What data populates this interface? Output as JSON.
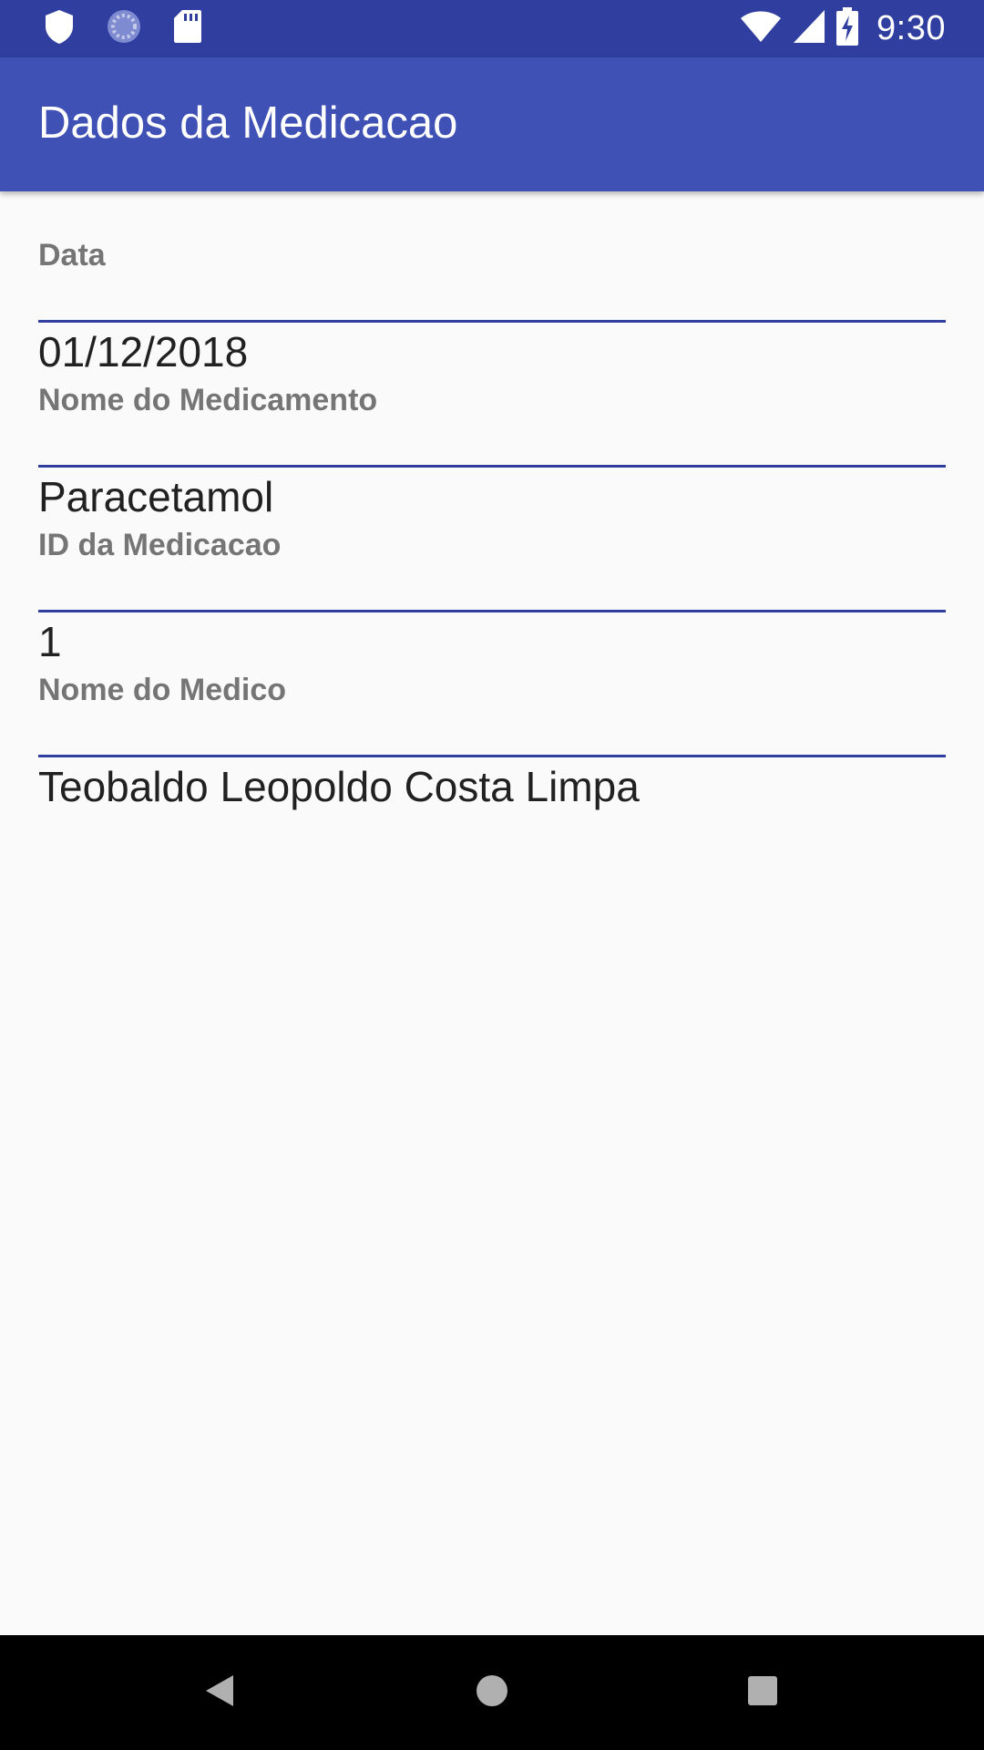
{
  "status_bar": {
    "time": "9:30",
    "left_icons": [
      "shield-icon",
      "sync-icon",
      "sd-card-icon"
    ],
    "right_icons": [
      "wifi-icon",
      "signal-icon",
      "battery-charging-icon"
    ]
  },
  "app_bar": {
    "title": "Dados da Medicacao",
    "background": "#3f51b5",
    "status_background": "#303f9f"
  },
  "fields": [
    {
      "label": "Data",
      "value": "01/12/2018"
    },
    {
      "label": "Nome do Medicamento",
      "value": "Paracetamol"
    },
    {
      "label": "ID da Medicacao",
      "value": "1"
    },
    {
      "label": "Nome do Medico",
      "value": "Teobaldo Leopoldo Costa Limpa"
    }
  ],
  "nav_bar": {
    "buttons": [
      "back-icon",
      "home-icon",
      "recents-icon"
    ]
  }
}
